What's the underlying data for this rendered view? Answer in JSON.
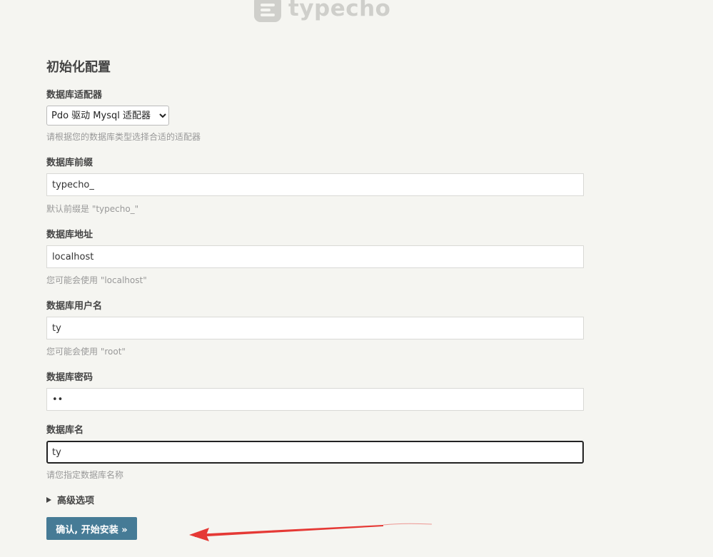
{
  "logo": {
    "text": "typecho"
  },
  "heading": "初始化配置",
  "adapter": {
    "label": "数据库适配器",
    "selected": "Pdo 驱动 Mysql 适配器",
    "description": "请根据您的数据库类型选择合适的适配器"
  },
  "prefix": {
    "label": "数据库前缀",
    "value": "typecho_",
    "description": "默认前缀是 \"typecho_\""
  },
  "host": {
    "label": "数据库地址",
    "value": "localhost",
    "description": "您可能会使用 \"localhost\""
  },
  "user": {
    "label": "数据库用户名",
    "value": "ty",
    "description": "您可能会使用 \"root\""
  },
  "password": {
    "label": "数据库密码",
    "value": "ty"
  },
  "dbname": {
    "label": "数据库名",
    "value": "ty",
    "description": "请您指定数据库名称"
  },
  "advanced": {
    "label": "高级选项"
  },
  "submit": {
    "label": "确认, 开始安装 »"
  },
  "colors": {
    "background": "#f5f5f1",
    "button": "#467b96",
    "annotation_arrow": "#e53935"
  }
}
